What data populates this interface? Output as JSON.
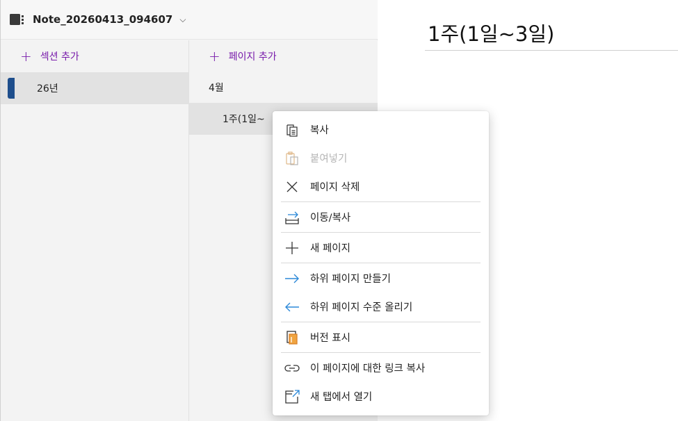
{
  "notebook": {
    "title": "Note_20260413_094607",
    "chevron": "⌵"
  },
  "sections": {
    "add_label": "섹션 추가",
    "items": [
      {
        "label": "26년",
        "color": "#1e4e8c"
      }
    ]
  },
  "pages": {
    "add_label": "페이지 추가",
    "items": [
      {
        "label": "4월"
      },
      {
        "label": "1주(1일~"
      }
    ]
  },
  "editor": {
    "title": "1주(1일~3일)"
  },
  "context_menu": {
    "items": [
      {
        "label": "복사",
        "icon": "copy-icon"
      },
      {
        "label": "붙여넣기",
        "icon": "paste-icon",
        "disabled": true
      },
      {
        "label": "페이지 삭제",
        "icon": "close-icon"
      },
      {
        "label": "이동/복사",
        "icon": "move-icon"
      },
      {
        "label": "새 페이지",
        "icon": "plus-icon"
      },
      {
        "label": "하위 페이지 만들기",
        "icon": "arrow-right-icon"
      },
      {
        "label": "하위 페이지 수준 올리기",
        "icon": "arrow-left-icon"
      },
      {
        "label": "버전 표시",
        "icon": "versions-icon"
      },
      {
        "label": "이 페이지에 대한 링크 복사",
        "icon": "link-icon"
      },
      {
        "label": "새 탭에서 열기",
        "icon": "open-new-tab-icon"
      }
    ]
  },
  "colors": {
    "accent": "#7719aa",
    "section_tab": "#1e4e8c",
    "arrow_blue": "#2b88d8",
    "versions_orange": "#d9822b"
  }
}
